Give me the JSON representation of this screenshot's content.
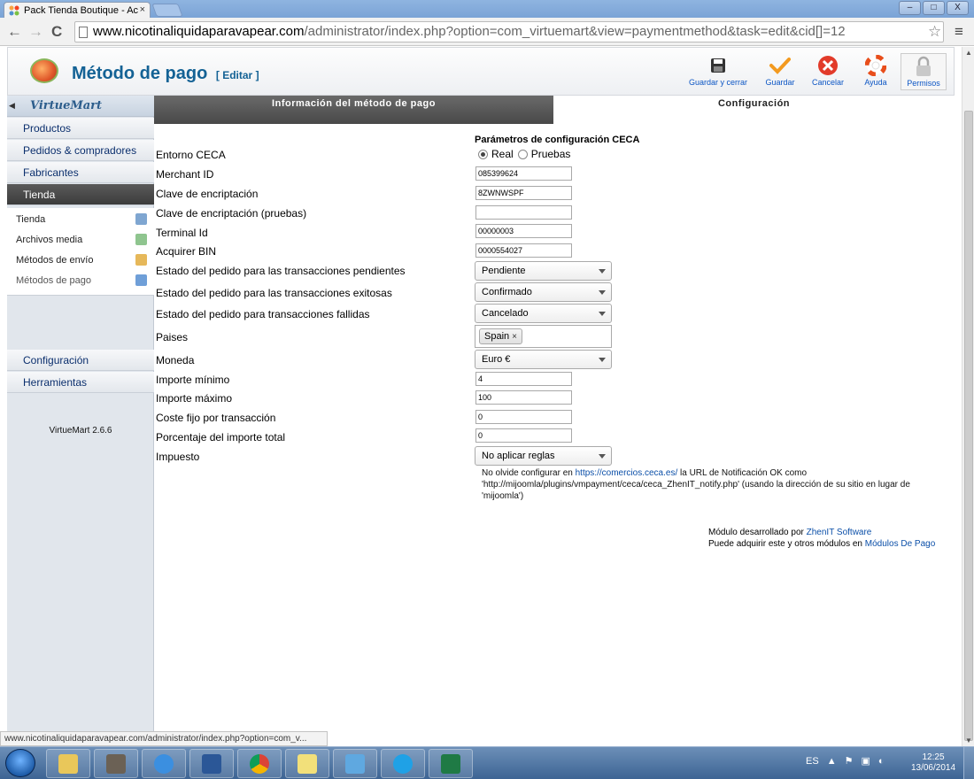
{
  "browser": {
    "tab_title": "Pack Tienda Boutique - Ac",
    "tab_close": "×",
    "url_host": "www.nicotinaliquidaparavapear.com",
    "url_path": "/administrator/index.php?option=com_virtuemart&view=paymentmethod&task=edit&cid[]=12",
    "back": "←",
    "forward": "→",
    "reload": "C",
    "star": "☆",
    "menu": "≡",
    "win_min": "–",
    "win_max": "□",
    "win_close": "X"
  },
  "header": {
    "title": "Método de pago",
    "subtitle": "[ Editar ]",
    "buttons": {
      "save_close": "Guardar y cerrar",
      "save": "Guardar",
      "cancel": "Cancelar",
      "help": "Ayuda",
      "permissions": "Permisos"
    }
  },
  "sidebar": {
    "brand": "VirtueMart",
    "sections": [
      "Productos",
      "Pedidos & compradores",
      "Fabricantes",
      "Tienda",
      "Configuración",
      "Herramientas"
    ],
    "shop_items": [
      "Tienda",
      "Archivos media",
      "Métodos de envío",
      "Métodos de pago"
    ],
    "version": "VirtueMart 2.6.6"
  },
  "tabs": {
    "info": "Información del método de pago",
    "config": "Configuración"
  },
  "form": {
    "params_title": "Parámetros de configuración CECA",
    "labels": {
      "env": "Entorno CECA",
      "merchant": "Merchant ID",
      "key": "Clave de encriptación",
      "key_test": "Clave de encriptación (pruebas)",
      "terminal": "Terminal Id",
      "acquirer": "Acquirer BIN",
      "pending": "Estado del pedido para las transacciones pendientes",
      "success": "Estado del pedido para las transacciones exitosas",
      "failed": "Estado del pedido para transacciones fallidas",
      "countries": "Paises",
      "currency": "Moneda",
      "min": "Importe mínimo",
      "max": "Importe máximo",
      "fixed": "Coste fijo por transacción",
      "percent": "Porcentaje del importe total",
      "tax": "Impuesto"
    },
    "env_options": [
      "Real",
      "Pruebas"
    ],
    "env_selected": "Real",
    "values": {
      "merchant": "085399624",
      "key": "8ZWNWSPF",
      "key_test": "",
      "terminal": "00000003",
      "acquirer": "0000554027",
      "pending": "Pendiente",
      "success": "Confirmado",
      "failed": "Cancelado",
      "country_tag": "Spain",
      "country_remove": "×",
      "currency": "Euro €",
      "min": "4",
      "max": "100",
      "fixed": "0",
      "percent": "0",
      "tax": "No aplicar reglas"
    },
    "note": {
      "prefix": "No olvide configurar en",
      "link": "https://comercios.ceca.es/",
      "middle": "la URL de Notificación OK como",
      "rest": "'http://mijoomla/plugins/vmpayment/ceca/ceca_ZhenIT_notify.php' (usando la dirección de su sitio en lugar de 'mijoomla')"
    },
    "credits": {
      "line1_prefix": "Módulo desarrollado por",
      "line1_link": "ZhenIT Software",
      "line2_prefix": "Puede adquirir este y otros módulos en",
      "line2_link": "Módulos De Pago"
    }
  },
  "status_url": "www.nicotinaliquidaparavapear.com/administrator/index.php?option=com_v...",
  "taskbar": {
    "lang": "ES",
    "time": "12:25",
    "date": "13/06/2014"
  },
  "colors": {
    "title_blue": "#146295",
    "dark_tab": "#484848",
    "sidebar_bg": "#e1e6ec",
    "link": "#0b4fa8"
  }
}
